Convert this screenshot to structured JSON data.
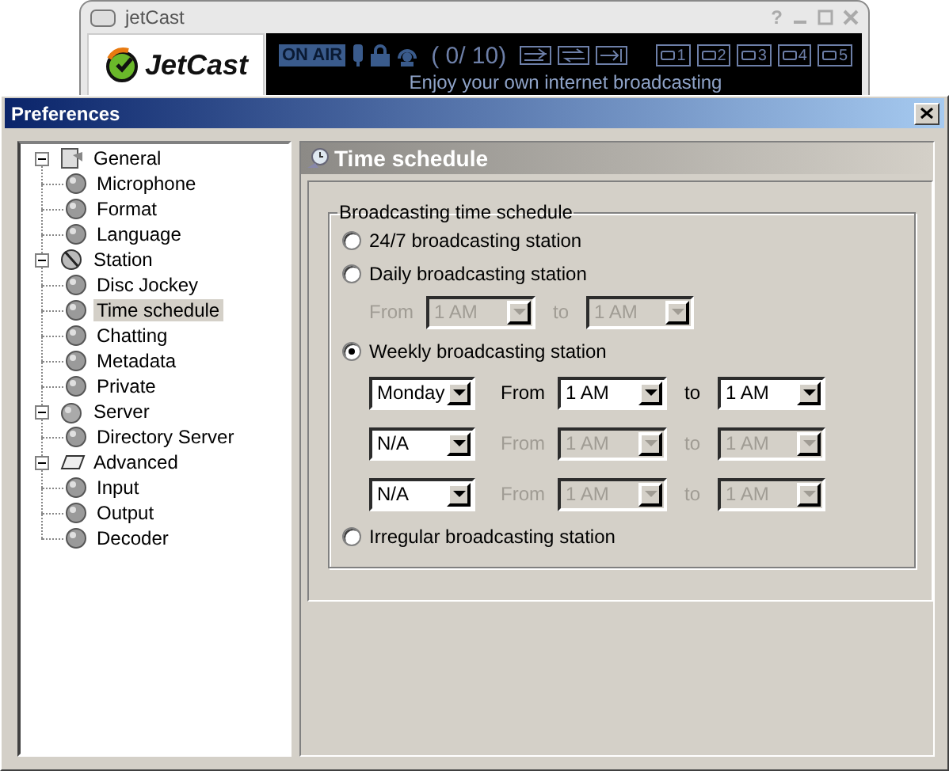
{
  "background_window": {
    "title": "jetCast",
    "help": "?",
    "logo_text": "JetCast",
    "on_air": "ON AIR",
    "counter": "( 0/ 10)",
    "presets": [
      "1",
      "2",
      "3",
      "4",
      "5"
    ],
    "tagline": "Enjoy your own internet broadcasting"
  },
  "preferences": {
    "title": "Preferences",
    "tree": [
      {
        "label": "General",
        "expanded": true,
        "selected": false,
        "children": [
          {
            "label": "Microphone",
            "selected": false
          },
          {
            "label": "Format",
            "selected": false
          },
          {
            "label": "Language",
            "selected": false
          }
        ]
      },
      {
        "label": "Station",
        "expanded": true,
        "selected": false,
        "children": [
          {
            "label": "Disc Jockey",
            "selected": false
          },
          {
            "label": "Time schedule",
            "selected": true
          },
          {
            "label": "Chatting",
            "selected": false
          },
          {
            "label": "Metadata",
            "selected": false
          },
          {
            "label": "Private",
            "selected": false
          }
        ]
      },
      {
        "label": "Server",
        "expanded": true,
        "selected": false,
        "children": [
          {
            "label": "Directory Server",
            "selected": false
          }
        ]
      },
      {
        "label": "Advanced",
        "expanded": true,
        "selected": false,
        "children": [
          {
            "label": "Input",
            "selected": false
          },
          {
            "label": "Output",
            "selected": false
          },
          {
            "label": "Decoder",
            "selected": false
          }
        ]
      }
    ],
    "page": {
      "title": "Time schedule",
      "group_label": "Broadcasting time schedule",
      "options": [
        {
          "label": "24/7 broadcasting station",
          "selected": false
        },
        {
          "label": "Daily broadcasting station",
          "selected": false,
          "rows": [
            {
              "from_label": "From",
              "from": "1 AM",
              "to_label": "to",
              "to": "1 AM",
              "disabled": true
            }
          ]
        },
        {
          "label": "Weekly broadcasting station",
          "selected": true,
          "rows": [
            {
              "day": "Monday",
              "from_label": "From",
              "from": "1 AM",
              "to_label": "to",
              "to": "1 AM",
              "disabled": false
            },
            {
              "day": "N/A",
              "from_label": "From",
              "from": "1 AM",
              "to_label": "to",
              "to": "1 AM",
              "disabled": true
            },
            {
              "day": "N/A",
              "from_label": "From",
              "from": "1 AM",
              "to_label": "to",
              "to": "1 AM",
              "disabled": true
            }
          ]
        },
        {
          "label": "Irregular broadcasting station",
          "selected": false
        }
      ]
    }
  }
}
